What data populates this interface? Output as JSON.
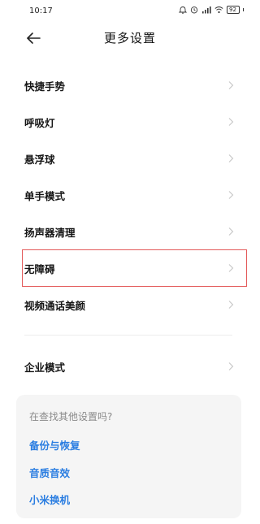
{
  "status_bar": {
    "time": "10:17",
    "battery_level": "92",
    "icons": [
      "alarm-icon",
      "clock-icon",
      "signal-icon",
      "wifi-icon",
      "battery-icon"
    ]
  },
  "header": {
    "back_icon": "arrow-left-icon",
    "title": "更多设置"
  },
  "menu": {
    "items": [
      {
        "label": "快捷手势"
      },
      {
        "label": "呼吸灯"
      },
      {
        "label": "悬浮球"
      },
      {
        "label": "单手模式"
      },
      {
        "label": "扬声器清理"
      },
      {
        "label": "无障碍"
      },
      {
        "label": "视频通话美颜"
      }
    ],
    "enterprise": {
      "label": "企业模式"
    }
  },
  "suggestions": {
    "hint": "在查找其他设置吗?",
    "links": [
      {
        "label": "备份与恢复"
      },
      {
        "label": "音质音效"
      },
      {
        "label": "小米换机"
      }
    ]
  },
  "colors": {
    "link": "#2a7de1",
    "highlight_border": "#e35a5a",
    "card_bg": "#f5f5f5"
  }
}
